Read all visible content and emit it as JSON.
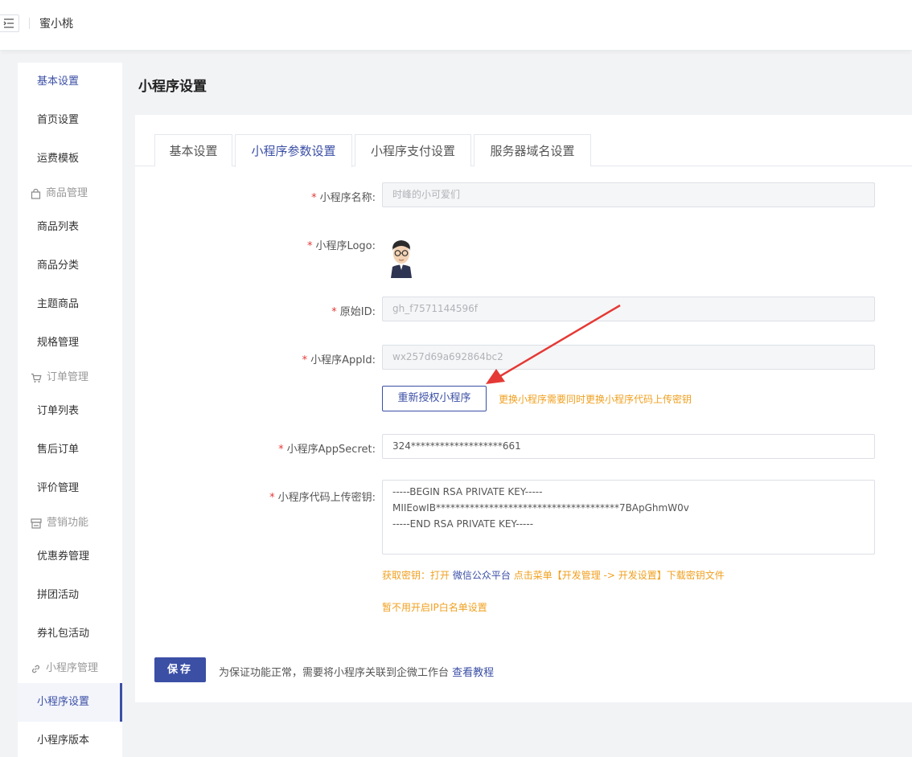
{
  "header": {
    "app_name": "蜜小桃",
    "menu_icon": "menu-fold-icon"
  },
  "sidebar": {
    "items": [
      {
        "label": "基本设置"
      },
      {
        "label": "首页设置"
      },
      {
        "label": "运费模板"
      },
      {
        "group": "商品管理",
        "icon": "shopping-bag-icon"
      },
      {
        "label": "商品列表"
      },
      {
        "label": "商品分类"
      },
      {
        "label": "主题商品"
      },
      {
        "label": "规格管理"
      },
      {
        "group": "订单管理",
        "icon": "cart-icon"
      },
      {
        "label": "订单列表"
      },
      {
        "label": "售后订单"
      },
      {
        "label": "评价管理"
      },
      {
        "group": "营销功能",
        "icon": "store-icon"
      },
      {
        "label": "优惠券管理"
      },
      {
        "label": "拼团活动"
      },
      {
        "label": "券礼包活动"
      },
      {
        "group": "小程序管理",
        "icon": "link-icon"
      },
      {
        "label": "小程序设置"
      },
      {
        "label": "小程序版本"
      }
    ]
  },
  "page": {
    "title": "小程序设置"
  },
  "tabs": [
    {
      "label": "基本设置"
    },
    {
      "label": "小程序参数设置"
    },
    {
      "label": "小程序支付设置"
    },
    {
      "label": "服务器域名设置"
    }
  ],
  "form": {
    "name_label": "小程序名称:",
    "name_value": "时峰的小可爱们",
    "logo_label": "小程序Logo:",
    "original_id_label": "原始ID:",
    "original_id_value": "gh_f7571144596f",
    "appid_label": "小程序AppId:",
    "appid_value": "wx257d69a692864bc2",
    "reauth_button": "重新授权小程序",
    "reauth_hint": "更换小程序需要同时更换小程序代码上传密钥",
    "appsecret_label": "小程序AppSecret:",
    "appsecret_value": "324*******************661",
    "upload_key_label": "小程序代码上传密钥:",
    "upload_key_lines": [
      "-----BEGIN RSA PRIVATE KEY-----",
      "MIIEowIB**************************************7BApGhmW0v",
      "-----END RSA PRIVATE KEY-----"
    ],
    "key_hint_prefix": "获取密钥：打开",
    "key_hint_link": "微信公众平台",
    "key_hint_suffix": "点击菜单【开发管理 -> 开发设置】下载密钥文件",
    "ip_hint": "暂不用开启IP白名单设置",
    "required_mark": "*"
  },
  "footer": {
    "save_button": "保存",
    "note": "为保证功能正常，需要将小程序关联到企微工作台",
    "note_link": "查看教程"
  },
  "colors": {
    "accent": "#3b4fa5",
    "warning": "#f0a020",
    "required": "#e53935",
    "annotation_arrow": "#e53935"
  }
}
